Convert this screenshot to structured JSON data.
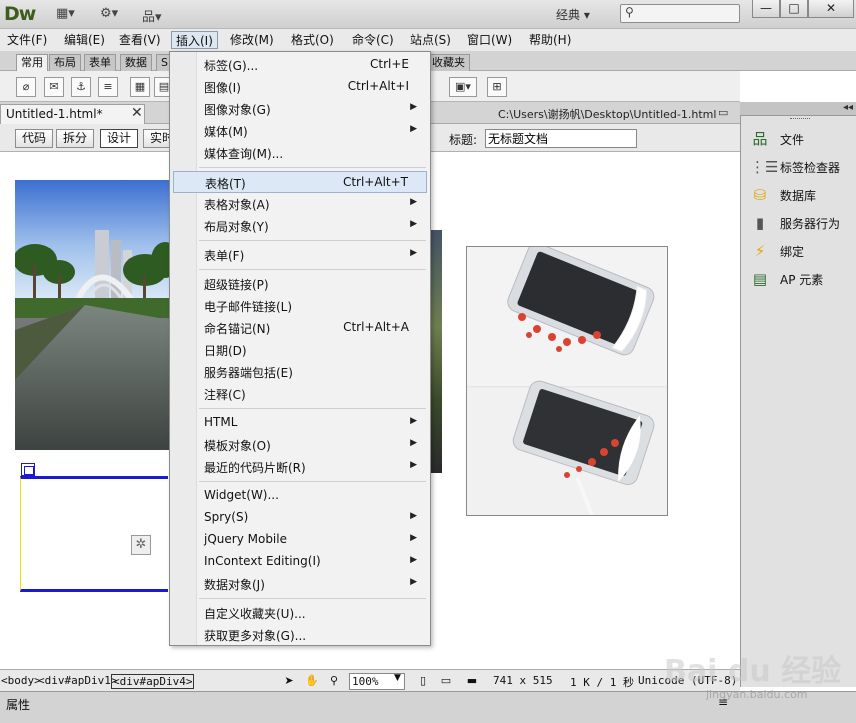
{
  "app": {
    "logo": "Dw",
    "layout_label": "经典 ▾",
    "window_controls": [
      "—",
      "□",
      "✕"
    ]
  },
  "menubar": [
    "文件(F)",
    "编辑(E)",
    "查看(V)",
    "插入(I)",
    "修改(M)",
    "格式(O)",
    "命令(C)",
    "站点(S)",
    "窗口(W)",
    "帮助(H)"
  ],
  "insert_tabs": [
    "常用",
    "布局",
    "表单",
    "数据",
    "S",
    "收藏夹"
  ],
  "doc_tab": {
    "label": "Untitled-1.html*",
    "close": "✕",
    "path": "C:\\Users\\谢扬帆\\Desktop\\Untitled-1.html"
  },
  "doc_toolbar": {
    "views": [
      "代码",
      "拆分",
      "设计",
      "实时"
    ],
    "title_label": "标题:",
    "title_value": "无标题文档"
  },
  "right_panel": {
    "items": [
      {
        "label": "文件",
        "icon": "files-icon"
      },
      {
        "label": "标签检查器",
        "icon": "tag-inspector-icon"
      },
      {
        "label": "数据库",
        "icon": "database-icon"
      },
      {
        "label": "服务器行为",
        "icon": "server-behaviors-icon"
      },
      {
        "label": "绑定",
        "icon": "bindings-icon"
      },
      {
        "label": "AP 元素",
        "icon": "ap-elements-icon"
      }
    ]
  },
  "statusbar": {
    "tags": [
      "<body>",
      "<div#apDiv1>",
      "<div#apDiv4>"
    ],
    "zoom": "100%",
    "size": "741 x 515",
    "download": "1 K / 1 秒",
    "encoding": "Unicode (UTF-8)"
  },
  "properties": {
    "label": "属性"
  },
  "watermark": {
    "main": "Bai du 经验",
    "sub": "jingyan.baidu.com"
  },
  "insert_menu": {
    "groups": [
      [
        {
          "label": "标签(G)...",
          "shortcut": "Ctrl+E",
          "submenu": false
        },
        {
          "label": "图像(I)",
          "shortcut": "Ctrl+Alt+I",
          "submenu": false
        },
        {
          "label": "图像对象(G)",
          "shortcut": "",
          "submenu": true
        },
        {
          "label": "媒体(M)",
          "shortcut": "",
          "submenu": true
        },
        {
          "label": "媒体查询(M)...",
          "shortcut": "",
          "submenu": false
        }
      ],
      [
        {
          "label": "表格(T)",
          "shortcut": "Ctrl+Alt+T",
          "submenu": false,
          "highlighted": true
        },
        {
          "label": "表格对象(A)",
          "shortcut": "",
          "submenu": true
        },
        {
          "label": "布局对象(Y)",
          "shortcut": "",
          "submenu": true
        }
      ],
      [
        {
          "label": "表单(F)",
          "shortcut": "",
          "submenu": true
        }
      ],
      [
        {
          "label": "超级链接(P)",
          "shortcut": "",
          "submenu": false
        },
        {
          "label": "电子邮件链接(L)",
          "shortcut": "",
          "submenu": false
        },
        {
          "label": "命名锚记(N)",
          "shortcut": "Ctrl+Alt+A",
          "submenu": false
        },
        {
          "label": "日期(D)",
          "shortcut": "",
          "submenu": false
        },
        {
          "label": "服务器端包括(E)",
          "shortcut": "",
          "submenu": false
        },
        {
          "label": "注释(C)",
          "shortcut": "",
          "submenu": false
        }
      ],
      [
        {
          "label": "HTML",
          "shortcut": "",
          "submenu": true
        },
        {
          "label": "模板对象(O)",
          "shortcut": "",
          "submenu": true
        },
        {
          "label": "最近的代码片断(R)",
          "shortcut": "",
          "submenu": true
        }
      ],
      [
        {
          "label": "Widget(W)...",
          "shortcut": "",
          "submenu": false
        },
        {
          "label": "Spry(S)",
          "shortcut": "",
          "submenu": true
        },
        {
          "label": "jQuery Mobile",
          "shortcut": "",
          "submenu": true
        },
        {
          "label": "InContext Editing(I)",
          "shortcut": "",
          "submenu": true
        },
        {
          "label": "数据对象(J)",
          "shortcut": "",
          "submenu": true
        }
      ],
      [
        {
          "label": "自定义收藏夹(U)...",
          "shortcut": "",
          "submenu": false
        },
        {
          "label": "获取更多对象(G)...",
          "shortcut": "",
          "submenu": false
        }
      ]
    ]
  }
}
